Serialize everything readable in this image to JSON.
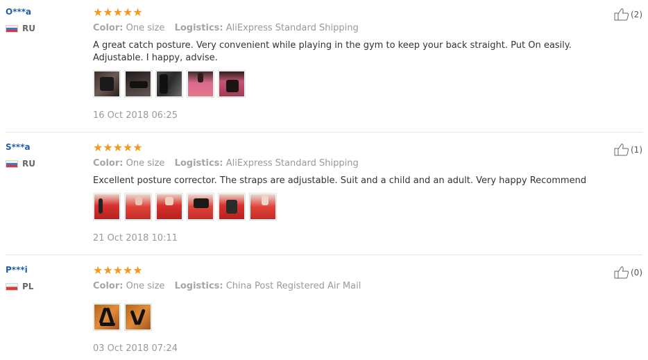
{
  "labels": {
    "color_key": "Color:",
    "logistics_key": "Logistics:"
  },
  "reviews": [
    {
      "user": "O***a",
      "country": "RU",
      "rating": "★★★★★",
      "color": "One size",
      "logistics": "AliExpress Standard Shipping",
      "text": "A great catch posture. Very convenient while playing in the gym to keep your back straight. Put On easily. Adjustable. I happy, advise.",
      "date": "16 Oct 2018 06:25",
      "likes": "(2)"
    },
    {
      "user": "S***a",
      "country": "RU",
      "rating": "★★★★★",
      "color": "One size",
      "logistics": "AliExpress Standard Shipping",
      "text": "Excellent posture corrector. The straps are adjustable. Suit and a child and an adult. Very happy Recommend",
      "date": "21 Oct 2018 10:11",
      "likes": "(1)"
    },
    {
      "user": "P***i",
      "country": "PL",
      "rating": "★★★★★",
      "color": "One size",
      "logistics": "China Post Registered Air Mail",
      "text": "",
      "date": "03 Oct 2018 07:24",
      "likes": "(0)"
    }
  ],
  "colors": {
    "username": "#1f5fa8",
    "stars": "#f29a1f",
    "meta": "#999999"
  },
  "icons": [
    "thumbs-up-icon",
    "star-icon",
    "flag-ru-icon",
    "flag-pl-icon"
  ]
}
